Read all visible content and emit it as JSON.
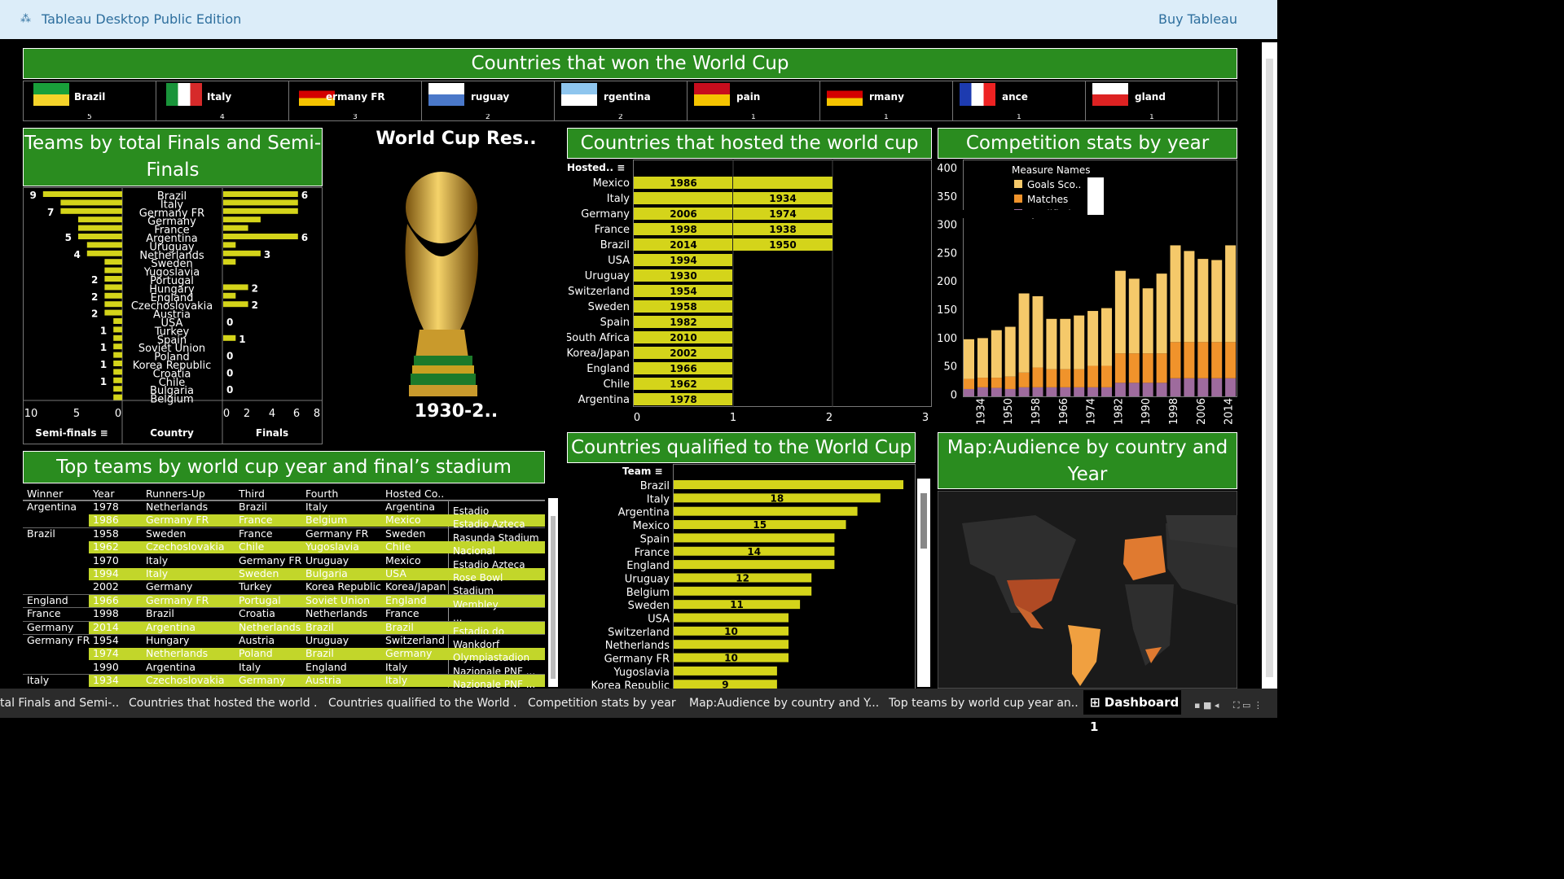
{
  "topbar": {
    "title": "Tableau Desktop Public Edition",
    "buy": "Buy Tableau"
  },
  "winners": {
    "title": "Countries that won the World Cup",
    "items": [
      {
        "name": "Brazil",
        "count": "5"
      },
      {
        "name": "Italy",
        "count": "4"
      },
      {
        "name": "ermany FR",
        "count": "3"
      },
      {
        "name": "ruguay",
        "count": "2"
      },
      {
        "name": "rgentina",
        "count": "2"
      },
      {
        "name": "pain",
        "count": "1"
      },
      {
        "name": "rmany",
        "count": "1"
      },
      {
        "name": "ance",
        "count": "1"
      },
      {
        "name": "gland",
        "count": "1"
      }
    ]
  },
  "semifinals": {
    "title": "Teams by total Finals and Semi-Finals",
    "countries": [
      "Brazil",
      "Italy",
      "Germany FR",
      "Germany",
      "France",
      "Argentina",
      "Uruguay",
      "Netherlands",
      "Sweden",
      "Yugoslavia",
      "Portugal",
      "Hungary",
      "England",
      "Czechoslovakia",
      "Austria",
      "USA",
      "Turkey",
      "Spain",
      "Soviet Union",
      "Poland",
      "Korea Republic",
      "Croatia",
      "Chile",
      "Bulgaria",
      "Belgium"
    ],
    "semis": [
      9,
      7,
      7,
      5,
      5,
      5,
      4,
      4,
      2,
      2,
      2,
      2,
      2,
      2,
      2,
      1,
      1,
      1,
      1,
      1,
      1,
      1,
      1,
      1,
      1
    ],
    "finals": [
      6,
      6,
      6,
      3,
      2,
      6,
      1,
      3,
      1,
      0,
      0,
      2,
      1,
      2,
      0,
      0,
      0,
      1,
      0,
      0,
      0,
      0,
      0,
      0,
      0
    ],
    "semi_labels": [
      {
        "i": 0,
        "t": "9"
      },
      {
        "i": 2,
        "t": "7"
      },
      {
        "i": 5,
        "t": "5"
      },
      {
        "i": 7,
        "t": "4"
      },
      {
        "i": 10,
        "t": "2"
      },
      {
        "i": 12,
        "t": "2"
      },
      {
        "i": 14,
        "t": "2"
      },
      {
        "i": 16,
        "t": "1"
      },
      {
        "i": 18,
        "t": "1"
      },
      {
        "i": 20,
        "t": "1"
      },
      {
        "i": 22,
        "t": "1"
      }
    ],
    "final_labels": [
      {
        "i": 0,
        "t": "6"
      },
      {
        "i": 5,
        "t": "6"
      },
      {
        "i": 7,
        "t": "3"
      },
      {
        "i": 11,
        "t": "2"
      },
      {
        "i": 13,
        "t": "2"
      },
      {
        "i": 15,
        "t": "0"
      },
      {
        "i": 17,
        "t": "1"
      },
      {
        "i": 19,
        "t": "0"
      },
      {
        "i": 21,
        "t": "0"
      },
      {
        "i": 23,
        "t": "0"
      }
    ],
    "semi_ticks": [
      "10",
      "5",
      "0"
    ],
    "final_ticks": [
      "0",
      "2",
      "4",
      "6",
      "8"
    ],
    "col_semis": "Semi-finals",
    "col_country": "Country",
    "col_finals": "Finals"
  },
  "trophy": {
    "title": "World Cup Res..",
    "years": "1930-2.."
  },
  "hosted": {
    "title": "Countries that hosted the world cup",
    "header": "Hosted..",
    "rows": [
      {
        "c": "Mexico",
        "y1": "1986",
        "y2": ""
      },
      {
        "c": "Italy",
        "y1": "",
        "y2": "1934"
      },
      {
        "c": "Germany",
        "y1": "2006",
        "y2": "1974"
      },
      {
        "c": "France",
        "y1": "1998",
        "y2": "1938"
      },
      {
        "c": "Brazil",
        "y1": "2014",
        "y2": "1950"
      },
      {
        "c": "USA",
        "y1": "1994",
        "y2": null
      },
      {
        "c": "Uruguay",
        "y1": "1930",
        "y2": null
      },
      {
        "c": "Switzerland",
        "y1": "1954",
        "y2": null
      },
      {
        "c": "Sweden",
        "y1": "1958",
        "y2": null
      },
      {
        "c": "Spain",
        "y1": "1982",
        "y2": null
      },
      {
        "c": "South Africa",
        "y1": "2010",
        "y2": null
      },
      {
        "c": "Korea/Japan",
        "y1": "2002",
        "y2": null
      },
      {
        "c": "England",
        "y1": "1966",
        "y2": null
      },
      {
        "c": "Chile",
        "y1": "1962",
        "y2": null
      },
      {
        "c": "Argentina",
        "y1": "1978",
        "y2": null
      }
    ],
    "ticks": [
      "0",
      "1",
      "2",
      "3"
    ]
  },
  "stats": {
    "title": "Competition stats by year",
    "legend_title": "Measure Names",
    "legend": [
      "Goals Sco..",
      "Matches",
      "Qualified"
    ],
    "yticks": [
      "400",
      "350",
      "300",
      "250",
      "200",
      "150",
      "100",
      "50",
      "0"
    ],
    "xticks": [
      "1934",
      "1950",
      "1958",
      "1966",
      "1974",
      "1982",
      "1990",
      "1998",
      "2006",
      "2014"
    ],
    "years": [
      "1930",
      "1934",
      "1938",
      "1950",
      "1954",
      "1958",
      "1962",
      "1966",
      "1970",
      "1974",
      "1978",
      "1982",
      "1986",
      "1990",
      "1994",
      "1998",
      "2002",
      "2006",
      "2010",
      "2014"
    ],
    "goals": [
      70,
      70,
      84,
      88,
      140,
      126,
      89,
      89,
      95,
      97,
      102,
      146,
      132,
      115,
      141,
      171,
      161,
      147,
      145,
      171
    ],
    "matches": [
      18,
      17,
      18,
      22,
      26,
      35,
      32,
      32,
      32,
      38,
      38,
      52,
      52,
      52,
      52,
      64,
      64,
      64,
      64,
      64
    ],
    "qualified": [
      13,
      16,
      15,
      13,
      16,
      16,
      16,
      16,
      16,
      16,
      16,
      24,
      24,
      24,
      24,
      32,
      32,
      32,
      32,
      32
    ],
    "colors": {
      "goals": "#f5c96a",
      "matches": "#f0932b",
      "qualified": "#9e6b9d"
    }
  },
  "topteams": {
    "title": "Top teams by world cup year and final’s stadium",
    "headers": [
      "Winner",
      "Year",
      "Runners-Up",
      "Third",
      "Fourth",
      "Hosted Co..",
      ""
    ],
    "rows": [
      [
        "Argentina",
        "1978",
        "Netherlands",
        "Brazil",
        "Italy",
        "Argentina",
        "Estadio"
      ],
      [
        "",
        "1986",
        "Germany FR",
        "France",
        "Belgium",
        "Mexico",
        "Estadio Azteca"
      ],
      [
        "Brazil",
        "1958",
        "Sweden",
        "France",
        "Germany FR",
        "Sweden",
        "Rasunda Stadium"
      ],
      [
        "",
        "1962",
        "Czechoslovakia",
        "Chile",
        "Yugoslavia",
        "Chile",
        "Nacional"
      ],
      [
        "",
        "1970",
        "Italy",
        "Germany FR",
        "Uruguay",
        "Mexico",
        "Estadio Azteca"
      ],
      [
        "",
        "1994",
        "Italy",
        "Sweden",
        "Bulgaria",
        "USA",
        "Rose Bowl"
      ],
      [
        "",
        "2002",
        "Germany",
        "Turkey",
        "Korea Republic",
        "Korea/Japan",
        "Stadium"
      ],
      [
        "England",
        "1966",
        "Germany FR",
        "Portugal",
        "Soviet Union",
        "England",
        "Wembley"
      ],
      [
        "France",
        "1998",
        "Brazil",
        "Croatia",
        "Netherlands",
        "France",
        "..."
      ],
      [
        "Germany",
        "2014",
        "Argentina",
        "Netherlands",
        "Brazil",
        "Brazil",
        "Estadio do"
      ],
      [
        "Germany FR",
        "1954",
        "Hungary",
        "Austria",
        "Uruguay",
        "Switzerland",
        "Wankdorf"
      ],
      [
        "",
        "1974",
        "Netherlands",
        "Poland",
        "Brazil",
        "Germany",
        "Olympiastadion"
      ],
      [
        "",
        "1990",
        "Argentina",
        "Italy",
        "England",
        "Italy",
        "Nazionale PNF ..."
      ],
      [
        "Italy",
        "1934",
        "Czechoslovakia",
        "Germany",
        "Austria",
        "Italy",
        "Nazionale PNF ..."
      ]
    ]
  },
  "qualified": {
    "title": "Countries qualified to the World Cup",
    "header": "Team",
    "rows": [
      {
        "c": "Brazil",
        "v": 20,
        "l": ""
      },
      {
        "c": "Italy",
        "v": 18,
        "l": "18"
      },
      {
        "c": "Argentina",
        "v": 16,
        "l": ""
      },
      {
        "c": "Mexico",
        "v": 15,
        "l": "15"
      },
      {
        "c": "Spain",
        "v": 14,
        "l": ""
      },
      {
        "c": "France",
        "v": 14,
        "l": "14"
      },
      {
        "c": "England",
        "v": 14,
        "l": ""
      },
      {
        "c": "Uruguay",
        "v": 12,
        "l": "12"
      },
      {
        "c": "Belgium",
        "v": 12,
        "l": ""
      },
      {
        "c": "Sweden",
        "v": 11,
        "l": "11"
      },
      {
        "c": "USA",
        "v": 10,
        "l": ""
      },
      {
        "c": "Switzerland",
        "v": 10,
        "l": "10"
      },
      {
        "c": "Netherlands",
        "v": 10,
        "l": ""
      },
      {
        "c": "Germany FR",
        "v": 10,
        "l": "10"
      },
      {
        "c": "Yugoslavia",
        "v": 9,
        "l": ""
      },
      {
        "c": "Korea Republic",
        "v": 9,
        "l": "9"
      }
    ]
  },
  "map": {
    "title": "Map:Audience by country and Year"
  },
  "tabs": [
    "tal Finals and Semi-...",
    "Countries that hosted the world ...",
    "Countries qualified to the World ...",
    "Competition stats by year",
    "Map:Audience by country and Y...",
    "Top teams by world cup year an...",
    "Dashboard 1"
  ]
}
